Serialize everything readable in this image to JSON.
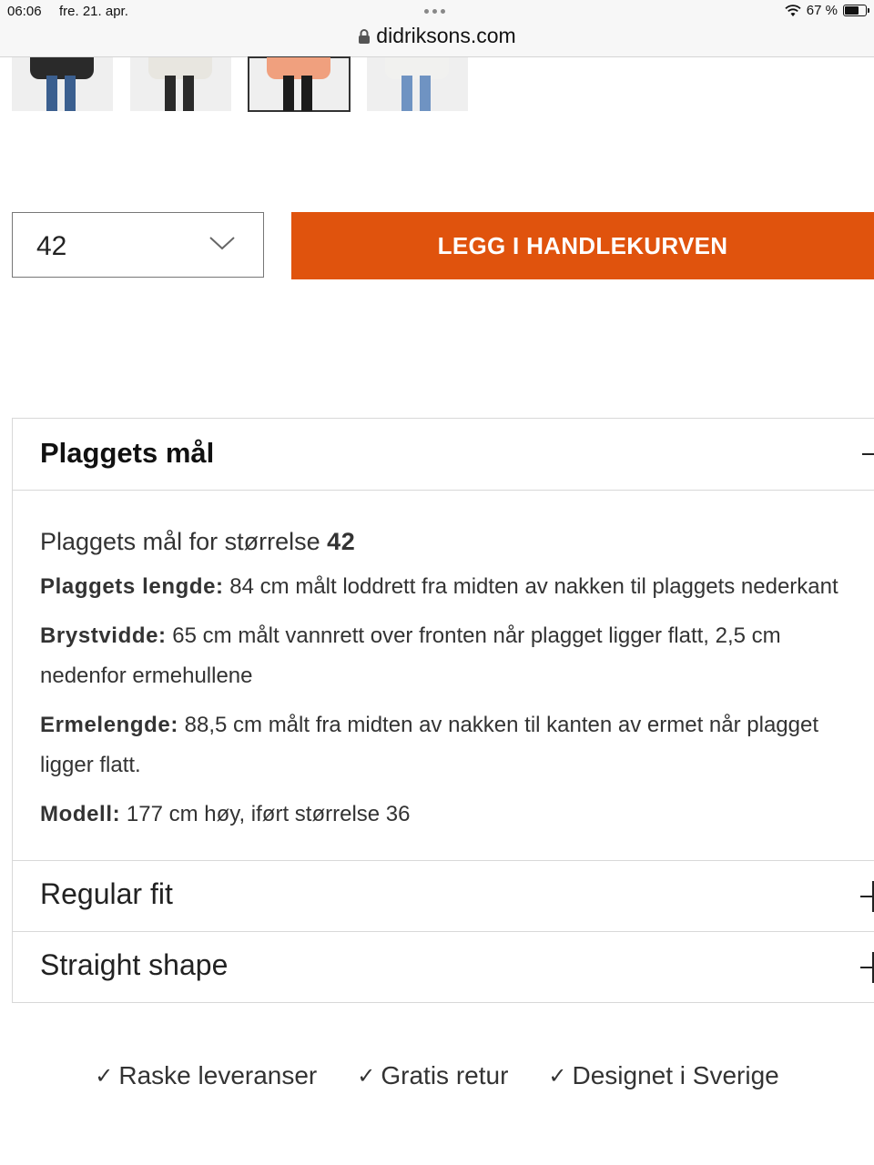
{
  "status": {
    "time": "06:06",
    "date": "fre. 21. apr.",
    "battery": "67 %"
  },
  "browser": {
    "url": "didriksons.com"
  },
  "thumbnails": [
    {
      "name": "thumb-black",
      "selected": false,
      "jacket": "#2a2a2a",
      "pants": "#3b5f8f"
    },
    {
      "name": "thumb-white",
      "selected": false,
      "jacket": "#e8e6e0",
      "pants": "#2a2a2a"
    },
    {
      "name": "thumb-peach",
      "selected": true,
      "jacket": "#f0a07e",
      "pants": "#1c1c1c"
    },
    {
      "name": "thumb-light",
      "selected": false,
      "jacket": "#f1f1ef",
      "pants": "#6f93c2"
    }
  ],
  "size_select": {
    "value": "42"
  },
  "add_to_cart": {
    "label": "LEGG I HANDLEKURVEN",
    "color": "#e0530d"
  },
  "measurements": {
    "title": "Plaggets mål",
    "lead_text": "Plaggets mål for størrelse ",
    "lead_size": "42",
    "rows": [
      {
        "label": "Plaggets lengde:",
        "text": " 84 cm målt loddrett fra midten av nakken til plaggets nederkant"
      },
      {
        "label": "Brystvidde:",
        "text": " 65 cm målt vannrett over fronten når plagget ligger flatt, 2,5 cm nedenfor ermehullene"
      },
      {
        "label": "Ermelengde:",
        "text": " 88,5 cm målt fra midten av nakken til kanten av ermet når plagget ligger flatt."
      },
      {
        "label": "Modell:",
        "text": " 177 cm høy, iført størrelse 36"
      }
    ]
  },
  "collapsed_sections": [
    {
      "title": "Regular fit"
    },
    {
      "title": "Straight shape"
    }
  ],
  "usps": [
    {
      "check": "✓",
      "text": "Raske leveranser"
    },
    {
      "check": "✓",
      "text": "Gratis retur"
    },
    {
      "check": "✓",
      "text": "Designet i Sverige"
    }
  ]
}
